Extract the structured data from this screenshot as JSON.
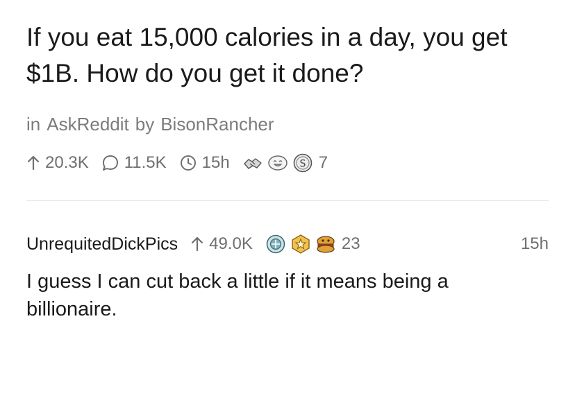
{
  "post": {
    "title": "If you eat 15,000 calories in a day, you get $1B. How do you get it done?",
    "in_label": "in",
    "subreddit": "AskReddit",
    "by_label": "by",
    "author": "BisonRancher",
    "upvotes": "20.3K",
    "comments": "11.5K",
    "age": "15h",
    "awards": [
      "handshake-award-icon",
      "laughing-face-award-icon",
      "silver-coin-award-icon"
    ],
    "award_count": "7"
  },
  "comment": {
    "author": "UnrequitedDickPics",
    "upvotes": "49.0K",
    "awards": [
      "platinum-award-icon",
      "gold-star-award-icon",
      "sandwich-face-award-icon"
    ],
    "award_count": "23",
    "age": "15h",
    "body": "I guess I can cut back a little if it means being a billionaire."
  },
  "colors": {
    "text": "#1a1a1b",
    "meta": "#7c7c7c",
    "divider": "#e4e4e4",
    "gold": "#f2c14e"
  }
}
